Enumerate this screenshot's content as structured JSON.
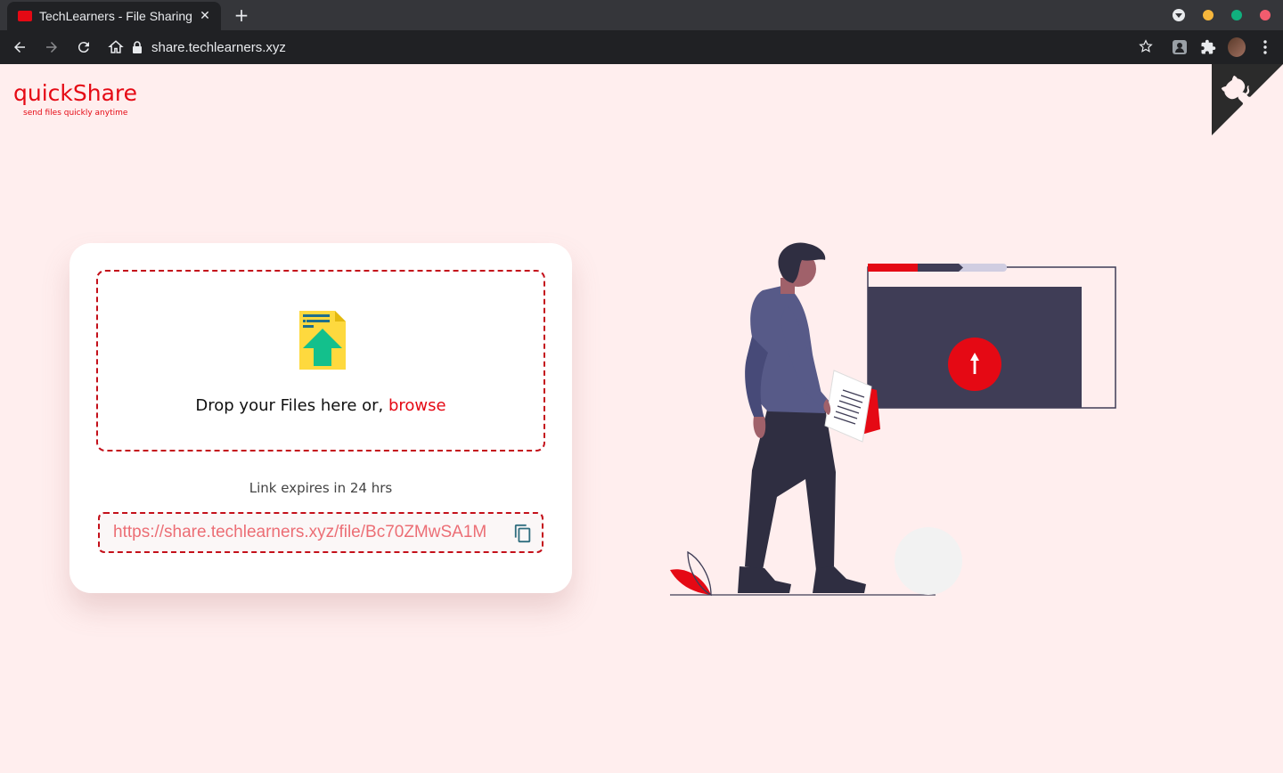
{
  "browser": {
    "tab_title": "TechLearners - File Sharing",
    "tab_close": "✕",
    "new_tab": "+",
    "url": "share.techlearners.xyz",
    "window_controls": {
      "yellow": "#f6b73c",
      "green": "#10b07e",
      "red": "#f25c6e"
    }
  },
  "brand": {
    "title": "quickShare",
    "tagline": "send files quickly anytime",
    "accent_color": "#e50914"
  },
  "upload": {
    "drop_text": "Drop your Files here or, ",
    "browse_label": "browse",
    "expire_text": "Link expires in 24 hrs",
    "share_link": "https://share.techlearners.xyz/file/Bc70ZMwSA1M"
  },
  "icons": {
    "upload": "file-upload-icon",
    "copy": "copy-icon",
    "github": "github-octocat-icon",
    "back": "arrow-left-icon",
    "forward": "arrow-right-icon",
    "reload": "reload-icon",
    "home": "home-icon",
    "lock": "lock-icon",
    "star": "star-icon",
    "extensions": "puzzle-icon"
  }
}
